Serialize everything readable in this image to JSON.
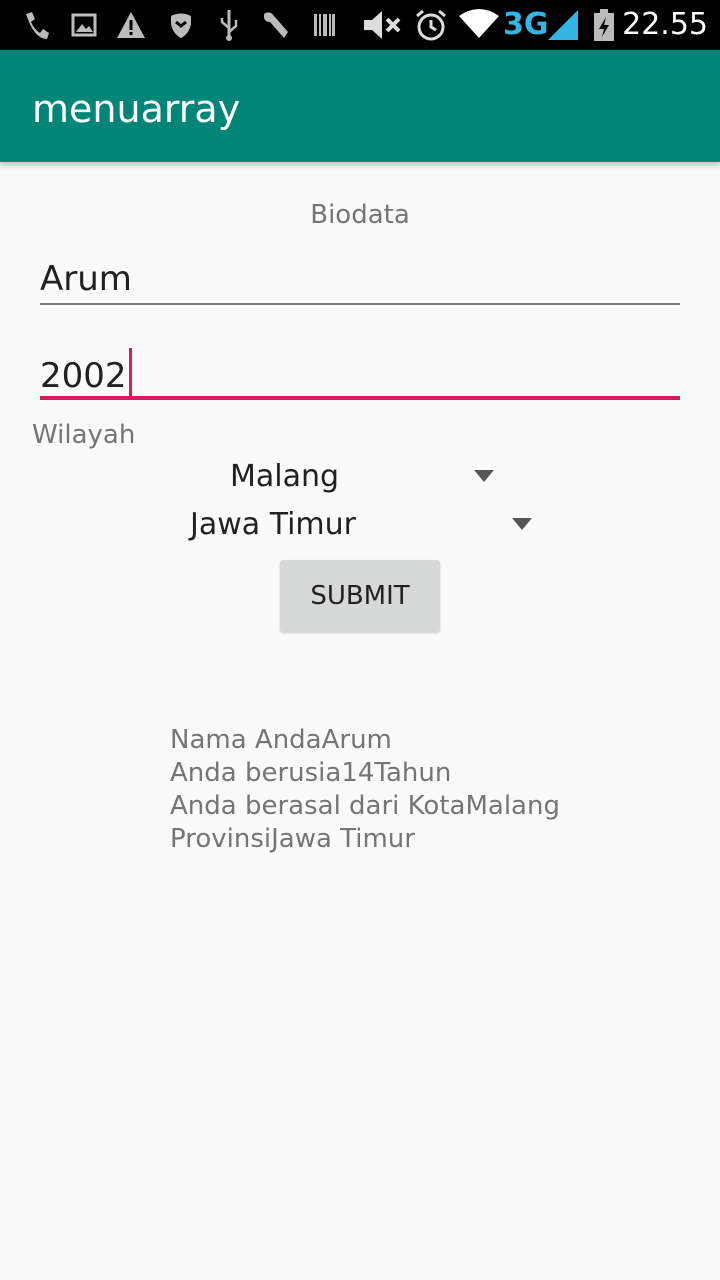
{
  "status_bar": {
    "time": "22.55",
    "network": "3G",
    "icons": [
      "phone-icon",
      "image-icon",
      "warning-icon",
      "shield-icon",
      "usb-icon",
      "wrench-icon",
      "barcode-icon",
      "mute-icon",
      "alarm-icon",
      "wifi-icon",
      "signal-icon",
      "battery-icon"
    ]
  },
  "app_bar": {
    "title": "menuarray",
    "color": "#008577"
  },
  "form": {
    "heading": "Biodata",
    "name_value": "Arum",
    "year_value": "2002",
    "region_label": "Wilayah",
    "city_selected": "Malang",
    "province_selected": "Jawa Timur",
    "submit_label": "SUBMIT",
    "accent_color": "#d81b60"
  },
  "result": {
    "lines": [
      "Nama AndaArum",
      "Anda berusia14Tahun",
      "Anda berasal dari KotaMalang",
      "ProvinsiJawa Timur"
    ]
  }
}
